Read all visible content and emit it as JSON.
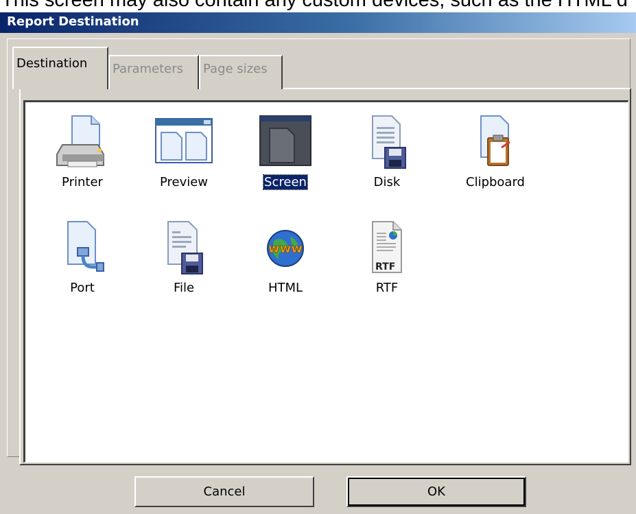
{
  "background_caption": "This screen may also contain any custom devices, such as the HTML d",
  "window": {
    "title": "Report Destination"
  },
  "tabs": [
    {
      "label": "Destination",
      "active": true
    },
    {
      "label": "Parameters",
      "active": false
    },
    {
      "label": "Page sizes",
      "active": false
    }
  ],
  "destinations": [
    {
      "label": "Printer",
      "icon": "printer-icon"
    },
    {
      "label": "Preview",
      "icon": "preview-icon"
    },
    {
      "label": "Screen",
      "icon": "screen-icon",
      "selected": true
    },
    {
      "label": "Disk",
      "icon": "disk-icon"
    },
    {
      "label": "Clipboard",
      "icon": "clipboard-icon"
    },
    {
      "label": "Port",
      "icon": "port-icon"
    },
    {
      "label": "File",
      "icon": "file-icon"
    },
    {
      "label": "HTML",
      "icon": "html-globe-icon"
    },
    {
      "label": "RTF",
      "icon": "rtf-document-icon",
      "badge": "RTF"
    }
  ],
  "buttons": {
    "cancel": "Cancel",
    "ok": "OK"
  },
  "colors": {
    "title_start": "#0a246a",
    "title_end": "#a6caf0",
    "selection": "#0a246a",
    "face": "#d4d0c8"
  }
}
